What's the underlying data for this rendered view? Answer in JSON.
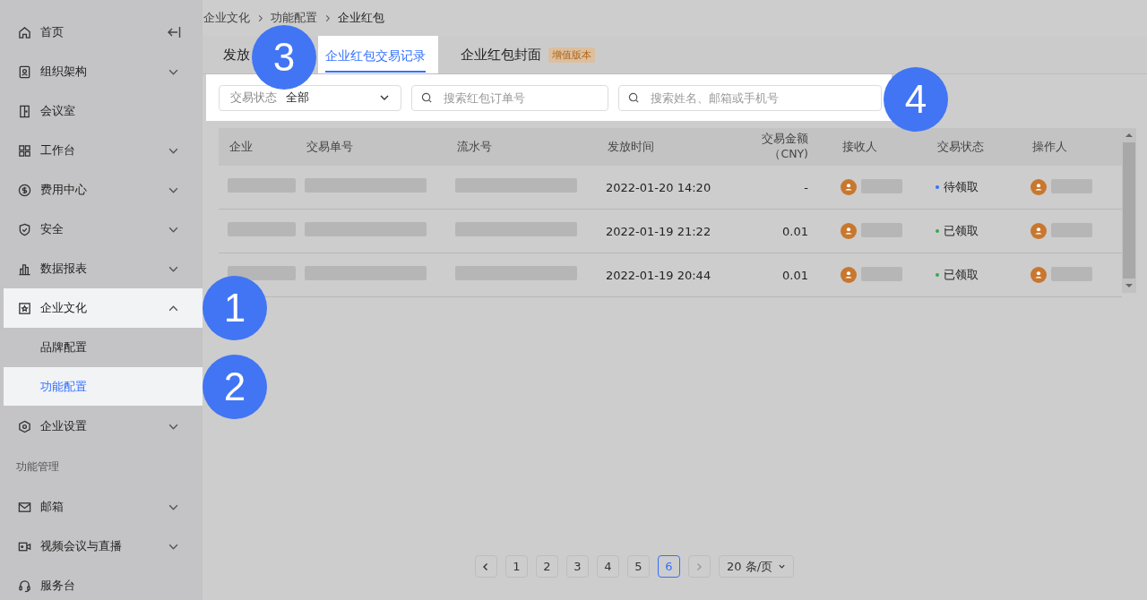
{
  "sidebar": {
    "items": [
      {
        "kind": "item",
        "label": "首页",
        "selected": false
      },
      {
        "kind": "item",
        "label": "组织架构",
        "expanded": false,
        "selected": false
      },
      {
        "kind": "item",
        "label": "会议室",
        "selected": false
      },
      {
        "kind": "item",
        "label": "工作台",
        "expanded": false,
        "selected": false
      },
      {
        "kind": "item",
        "label": "费用中心",
        "expanded": false,
        "selected": false
      },
      {
        "kind": "item",
        "label": "安全",
        "expanded": false,
        "selected": false
      },
      {
        "kind": "item",
        "label": "数据报表",
        "expanded": false,
        "selected": false
      },
      {
        "kind": "item",
        "label": "企业文化",
        "expanded": true,
        "selected": true,
        "callout": "1",
        "children": [
          {
            "label": "品牌配置",
            "selected": false
          },
          {
            "label": "功能配置",
            "selected": true,
            "callout": "2"
          }
        ]
      },
      {
        "kind": "item",
        "label": "企业设置",
        "expanded": false,
        "selected": false
      },
      {
        "kind": "section",
        "label": "功能管理"
      },
      {
        "kind": "item",
        "label": "邮箱",
        "expanded": false,
        "selected": false
      },
      {
        "kind": "item",
        "label": "视频会议与直播",
        "expanded": false,
        "selected": false
      },
      {
        "kind": "item",
        "label": "服务台",
        "selected": false
      }
    ]
  },
  "breadcrumb": [
    "企业文化",
    "功能配置",
    "企业红包"
  ],
  "tabs": [
    {
      "label": "发放",
      "selected": false
    },
    {
      "label": "企业红包交易记录",
      "selected": true,
      "callout": "3"
    },
    {
      "label": "企业红包封面",
      "selected": false,
      "badge": "增值版本"
    }
  ],
  "filters": {
    "callout": "4",
    "status_select": {
      "label": "交易状态",
      "value": "全部"
    },
    "order_search": {
      "placeholder": "搜索红包订单号"
    },
    "person_search": {
      "placeholder": "搜索姓名、邮箱或手机号"
    }
  },
  "table": {
    "columns": [
      "企业",
      "交易单号",
      "流水号",
      "发放时间",
      "交易金额（CNY)",
      "接收人",
      "交易状态",
      "操作人"
    ],
    "rows": [
      {
        "time": "2022-01-20 14:20",
        "amount": "-",
        "status": "待领取",
        "color": "#3370ff"
      },
      {
        "time": "2022-01-19 21:22",
        "amount": "0.01",
        "status": "已领取",
        "color": "#34a853"
      },
      {
        "time": "2022-01-19 20:44",
        "amount": "0.01",
        "status": "已领取",
        "color": "#34a853"
      }
    ]
  },
  "pagination": {
    "prev_disabled": false,
    "next_disabled": true,
    "pages": [
      {
        "label": "1",
        "selected": false
      },
      {
        "label": "2",
        "selected": false
      },
      {
        "label": "3",
        "selected": false
      },
      {
        "label": "4",
        "selected": false
      },
      {
        "label": "5",
        "selected": false
      },
      {
        "label": "6",
        "selected": true
      }
    ],
    "page_size": "20 条/页"
  }
}
